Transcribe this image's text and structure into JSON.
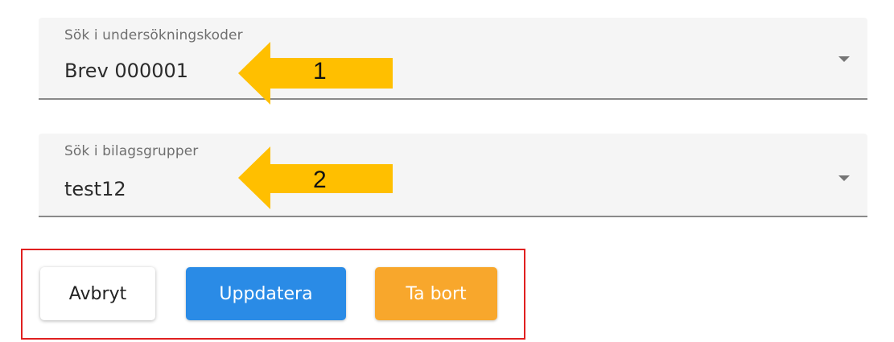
{
  "survey_code_field": {
    "label": "Sök i undersökningskoder",
    "value": "Brev 000001"
  },
  "attachment_group_field": {
    "label": "Sök i bilagsgrupper",
    "value": "test12"
  },
  "annotations": {
    "arrow_1_number": "1",
    "arrow_2_number": "2",
    "arrow_color": "#ffbf00",
    "frame_color": "#e02020"
  },
  "actions": {
    "cancel_label": "Avbryt",
    "update_label": "Uppdatera",
    "delete_label": "Ta bort",
    "update_color": "#2a8be6",
    "delete_color": "#f8a72c"
  },
  "icons": {
    "dropdown": "chevron-down-icon"
  }
}
